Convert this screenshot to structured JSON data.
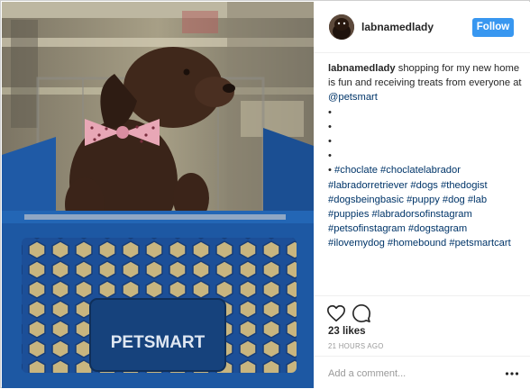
{
  "post": {
    "username": "labnamedlady",
    "follow_label": "Follow",
    "caption": {
      "username": "labnamedlady",
      "text": "shopping for my new home is fun and receiving treats from everyone at",
      "mention": "@petsmart",
      "bullets": [
        "•",
        "•",
        "•",
        "•"
      ],
      "bullet_final": "•",
      "hashtags": "#choclate #choclatelabrador #labradorretriever #dogs #thedogist #dogsbeingbasic #puppy #dog #lab #puppies #labradorsofinstagram #petsofinstagram #dogstagram #ilovemydog #homebound #petsmartcart"
    },
    "likes": "23 likes",
    "time": "21 HOURS AGO",
    "comment_placeholder": "Add a comment...",
    "photo_text": "PETSMART"
  },
  "colors": {
    "follow_button": "#3897f0",
    "link": "#003569",
    "cart_blue": "#1c5fae"
  },
  "icons": [
    "heart-icon",
    "comment-icon",
    "more-options-icon",
    "avatar"
  ]
}
